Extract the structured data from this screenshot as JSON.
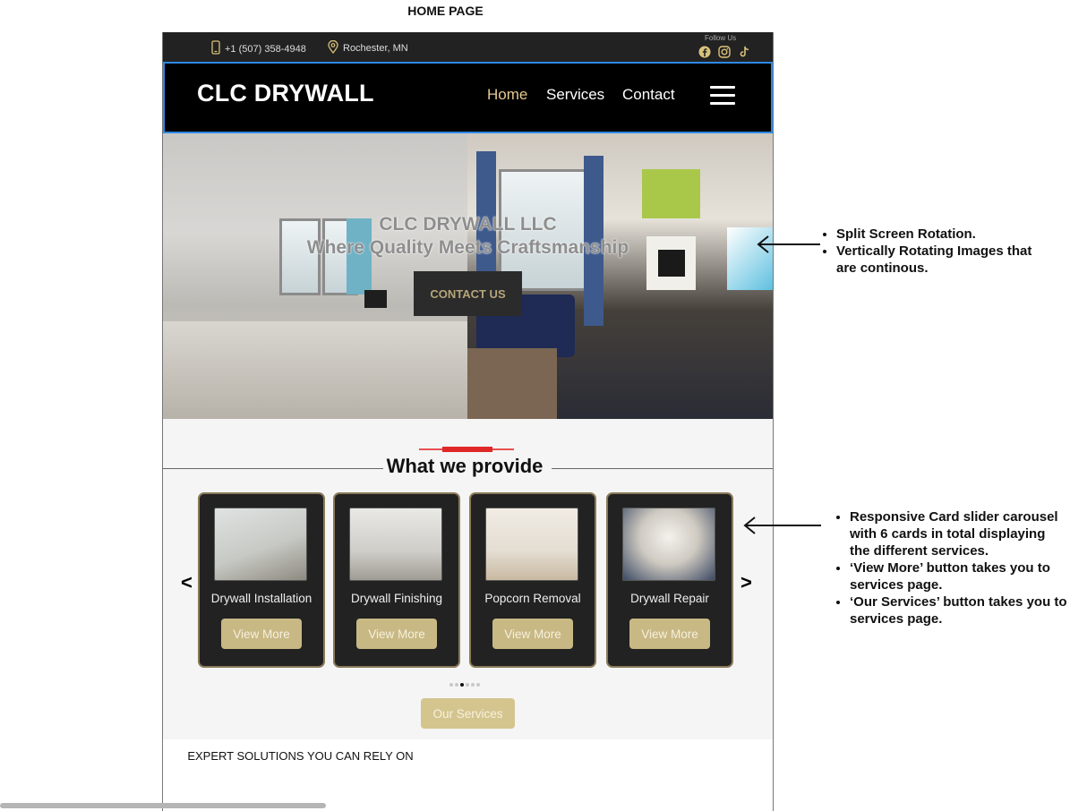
{
  "page_label": "HOME PAGE",
  "topbar": {
    "phone": "+1 (507) 358-4948",
    "location": "Rochester, MN",
    "follow_label": "Follow Us",
    "socials": [
      "facebook-icon",
      "instagram-icon",
      "tiktok-icon"
    ]
  },
  "nav": {
    "logo": "CLC DRYWALL",
    "links": [
      "Home",
      "Services",
      "Contact"
    ],
    "active": "Home"
  },
  "hero": {
    "title_line1": "CLC DRYWALL LLC",
    "title_line2": "Where Quality Meets Craftsmanship",
    "cta": "CONTACT US"
  },
  "services": {
    "title": "What we provide",
    "prev": "<",
    "next": ">",
    "cards": [
      {
        "title": "Drywall Installation",
        "button": "View More"
      },
      {
        "title": "Drywall Finishing",
        "button": "View More"
      },
      {
        "title": "Popcorn Removal",
        "button": "View More"
      },
      {
        "title": "Drywall Repair",
        "button": "View More"
      }
    ],
    "dots_total": 6,
    "dots_active_index": 2,
    "our_services_button": "Our Services"
  },
  "footer_heading": "EXPERT SOLUTIONS YOU CAN RELY ON",
  "annotations": {
    "hero": [
      "Split Screen Rotation.",
      "Vertically Rotating Images that are continous."
    ],
    "carousel": [
      "Responsive Card slider carousel with 6 cards in total displaying the different services.",
      "‘View More’ button takes you to services page.",
      "‘Our Services’ button takes you to services page."
    ]
  },
  "colors": {
    "accent_gold": "#c8b884",
    "nav_active": "#e6c98e",
    "topbar_bg": "#222222",
    "nav_bg": "#000000",
    "deco_red": "#e02828"
  }
}
